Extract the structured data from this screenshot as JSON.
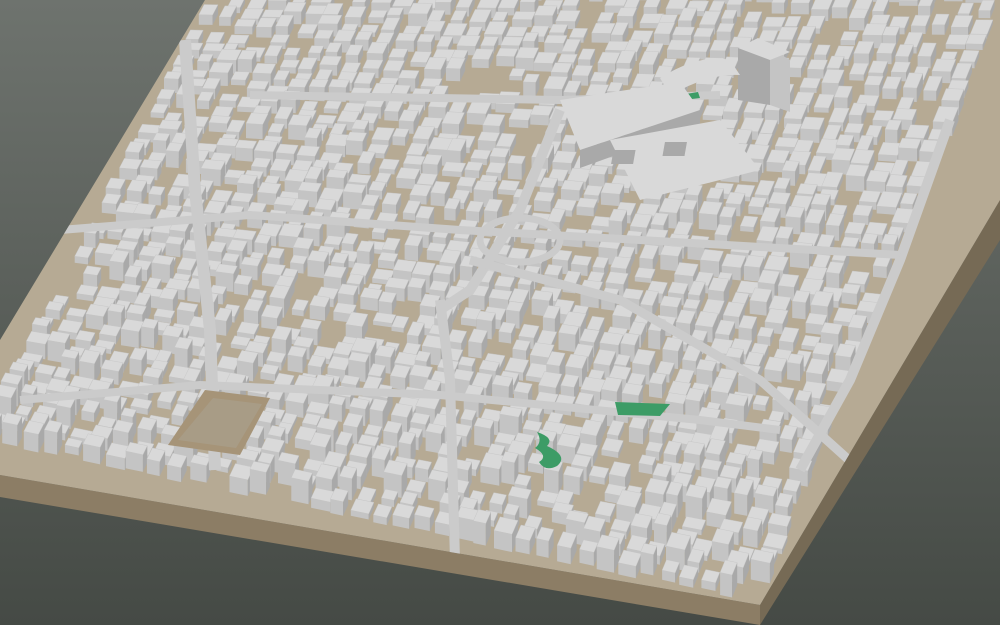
{
  "scene": {
    "subject": "3d-city-block-model",
    "colors": {
      "background_top": "#6e736e",
      "background_bottom": "#454a45",
      "ground": "#b6aa94",
      "ground_dark": "#a89c86",
      "base_front": "#8c7d65",
      "base_side": "#766a55",
      "building_roof": "#d9d9d9",
      "building_wall_light": "#c4c4c4",
      "building_wall_dark": "#a9a9a9",
      "street": "#cbcbcb",
      "plaza": "#a69478",
      "park": "#3d9c66"
    }
  }
}
